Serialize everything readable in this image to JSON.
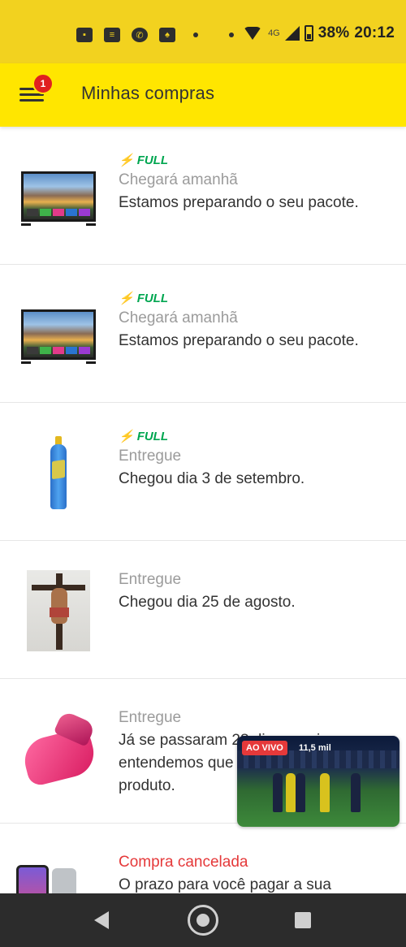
{
  "status_bar": {
    "network": "4G",
    "battery": "38%",
    "time": "20:12",
    "notification_icons": [
      "image-icon",
      "message-icon",
      "whatsapp-icon",
      "game-icon"
    ]
  },
  "app_bar": {
    "title": "Minhas compras",
    "badge_count": "1"
  },
  "purchases": [
    {
      "thumbnail": "tv",
      "full_badge": "FULL",
      "status": "Chegará amanhã",
      "description": "Estamos preparando o seu pacote."
    },
    {
      "thumbnail": "tv",
      "full_badge": "FULL",
      "status": "Chegará amanhã",
      "description": "Estamos preparando o seu pacote."
    },
    {
      "thumbnail": "bottle",
      "full_badge": "FULL",
      "status": "Entregue",
      "description": "Chegou dia 3 de setembro."
    },
    {
      "thumbnail": "crucifix",
      "full_badge": "",
      "status": "Entregue",
      "description": "Chegou dia 25 de agosto."
    },
    {
      "thumbnail": "perfume",
      "full_badge": "",
      "status": "Entregue",
      "description": "Já se passaram 28 dias, por isso entendemos que você recebeu o produto."
    },
    {
      "thumbnail": "phone",
      "full_badge": "",
      "status": "Compra cancelada",
      "description": "O prazo para você pagar a sua"
    }
  ],
  "live_video": {
    "badge": "AO VIVO",
    "viewers": "11,5 mil"
  },
  "colors": {
    "status_bar": "#f2d21f",
    "app_bar": "#ffe600",
    "full_green": "#00a650",
    "cancel_red": "#e5393a",
    "badge_red": "#e02020",
    "nav_bar": "#2c2c2c"
  }
}
